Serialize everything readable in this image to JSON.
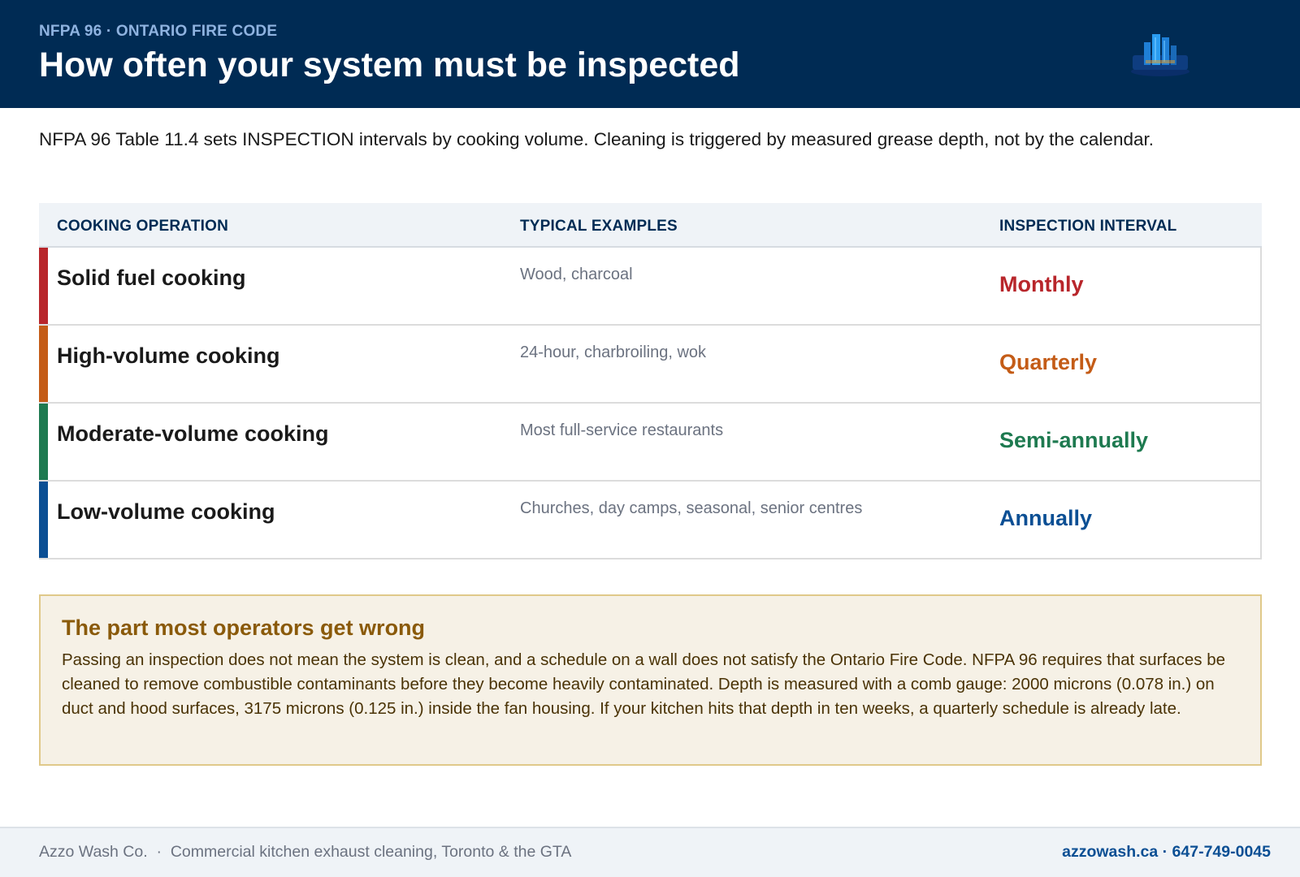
{
  "header": {
    "eyebrow": "NFPA 96 · ONTARIO FIRE CODE",
    "title": "How often your system must be inspected"
  },
  "intro": "NFPA 96 Table 11.4 sets INSPECTION intervals by cooking volume. Cleaning is triggered by measured grease depth, not by the calendar.",
  "table": {
    "columns": [
      "COOKING OPERATION",
      "TYPICAL EXAMPLES",
      "INSPECTION INTERVAL"
    ],
    "rows": [
      {
        "operation": "Solid fuel cooking",
        "examples": "Wood, charcoal",
        "interval": "Monthly",
        "color": "#b8262b"
      },
      {
        "operation": "High-volume cooking",
        "examples": "24-hour, charbroiling, wok",
        "interval": "Quarterly",
        "color": "#c45c17"
      },
      {
        "operation": "Moderate-volume cooking",
        "examples": "Most full-service restaurants",
        "interval": "Semi-annually",
        "color": "#1e7a50"
      },
      {
        "operation": "Low-volume cooking",
        "examples": "Churches, day camps, seasonal, senior centres",
        "interval": "Annually",
        "color": "#0b4f94"
      }
    ]
  },
  "callout": {
    "title": "The part most operators get wrong",
    "body": "Passing an inspection does not mean the system is clean, and a schedule on a wall does not satisfy the Ontario Fire Code. NFPA 96 requires that surfaces be cleaned to remove combustible contaminants before they become heavily contaminated. Depth is measured with a comb gauge: 2000 microns (0.078 in.) on duct and hood surfaces, 3175 microns (0.125 in.) inside the fan housing. If your kitchen hits that depth in ten weeks, a quarterly schedule is already late."
  },
  "footer": {
    "company": "Azzo Wash Co.",
    "separator": "·",
    "tagline": "Commercial kitchen exhaust cleaning, Toronto & the GTA",
    "contact": "azzowash.ca · 647-749-0045"
  },
  "logo": {
    "icon": "building-logo-icon"
  }
}
